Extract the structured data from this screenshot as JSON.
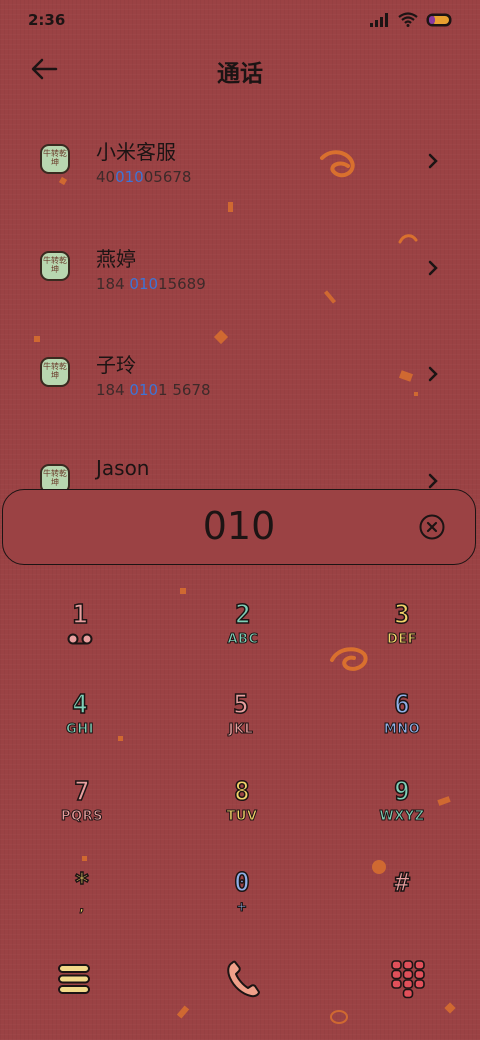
{
  "status": {
    "time": "2:36"
  },
  "header": {
    "title": "通话"
  },
  "avatar_text": "牛转乾坤",
  "contacts": [
    {
      "name": "小米客服",
      "num_pre": "40",
      "num_hl": "010",
      "num_post": "05678"
    },
    {
      "name": "燕婷",
      "num_pre": "184 ",
      "num_hl": "010",
      "num_post": "15689"
    },
    {
      "name": "子玲",
      "num_pre": "184 ",
      "num_hl": "010",
      "num_post": "1 5678"
    },
    {
      "name": "Jason",
      "num_pre": "",
      "num_hl": "",
      "num_post": ""
    }
  ],
  "search": {
    "value": "010"
  },
  "keypad": [
    {
      "digit": "1",
      "letters": "",
      "color": "#e8a0a0",
      "lcolor": "#e8a0a0"
    },
    {
      "digit": "2",
      "letters": "ABC",
      "color": "#7fd0b8",
      "lcolor": "#7fd0b8"
    },
    {
      "digit": "3",
      "letters": "DEF",
      "color": "#f2d36a",
      "lcolor": "#f2d36a"
    },
    {
      "digit": "4",
      "letters": "GHI",
      "color": "#7fd0b8",
      "lcolor": "#7fd0b8"
    },
    {
      "digit": "5",
      "letters": "JKL",
      "color": "#e8a0a0",
      "lcolor": "#e8a0a0"
    },
    {
      "digit": "6",
      "letters": "MNO",
      "color": "#8fb0e8",
      "lcolor": "#8fb0e8"
    },
    {
      "digit": "7",
      "letters": "PQRS",
      "color": "#e8a0a0",
      "lcolor": "#e8a0a0"
    },
    {
      "digit": "8",
      "letters": "TUV",
      "color": "#f2d36a",
      "lcolor": "#f2d36a"
    },
    {
      "digit": "9",
      "letters": "WXYZ",
      "color": "#7fd0b8",
      "lcolor": "#7fd0b8"
    },
    {
      "digit": "*",
      "letters": ",",
      "color": "#f2d36a",
      "lcolor": "#f2d36a"
    },
    {
      "digit": "0",
      "letters": "+",
      "color": "#8fb0e8",
      "lcolor": "#8fb0e8"
    },
    {
      "digit": "#",
      "letters": "",
      "color": "#e8a0a0",
      "lcolor": "#e8a0a0"
    }
  ],
  "colors": {
    "background": "#9b4244",
    "highlight": "#3d74d6",
    "call": "#f0a08a",
    "menu": "#f2d98a",
    "pad": "#e0505a"
  }
}
